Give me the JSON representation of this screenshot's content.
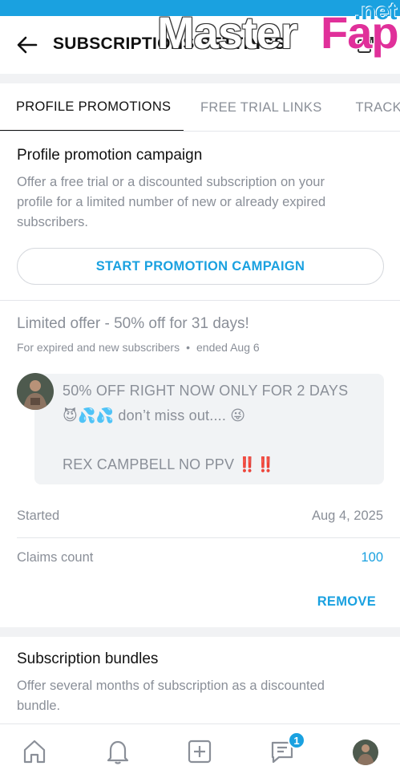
{
  "header": {
    "title": "SUBSCRIPTIONS SETTINGS"
  },
  "watermark": {
    "text_1": "Master",
    "text_2": "Fap",
    "text_3": ".net"
  },
  "tabs": [
    {
      "label": "PROFILE PROMOTIONS",
      "active": true
    },
    {
      "label": "FREE TRIAL LINKS",
      "active": false
    },
    {
      "label": "TRACKING LINKS",
      "active": false
    }
  ],
  "promotion_campaign": {
    "title": "Profile promotion campaign",
    "description_1": "Offer a free trial or a discounted subscription on your",
    "description_2": "profile for a limited number of new or already expired",
    "description_3": "subscribers.",
    "button_label": "START PROMOTION CAMPAIGN"
  },
  "offer": {
    "title": "Limited offer - 50% off for 31 days!",
    "audience": "For expired and new subscribers",
    "status": "ended Aug 6",
    "message_line_1": "50% OFF RIGHT NOW ONLY FOR 2 DAYS",
    "message_line_2": "😈💦💦 don’t miss out.... 😜",
    "message_line_3": "REX CAMPBELL NO PPV ‼️‼️",
    "started_label": "Started",
    "started_value": "Aug 4, 2025",
    "claims_label": "Claims count",
    "claims_value": "100",
    "remove_label": "REMOVE"
  },
  "bundles": {
    "title": "Subscription bundles",
    "description_1": "Offer several months of subscription as a discounted",
    "description_2": "bundle."
  },
  "bottom_nav": {
    "messages_badge": "1"
  },
  "colors": {
    "accent": "#1aa1e0",
    "muted_text": "#8a8f98",
    "divider": "#e4e6ea",
    "bubble_bg": "#f1f3f5"
  }
}
